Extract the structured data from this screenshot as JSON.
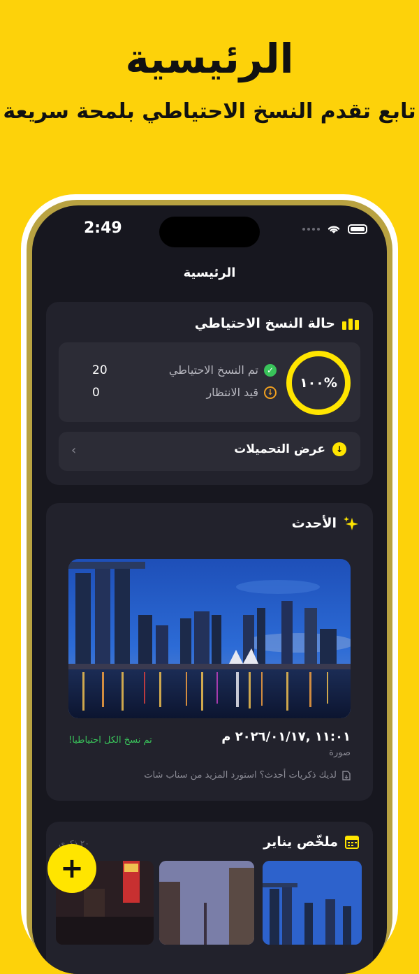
{
  "promo": {
    "title": "الرئيسية",
    "subtitle": "تابع تقدم النسخ الاحتياطي بلمحة سريعة"
  },
  "status_bar": {
    "time": "2:49"
  },
  "nav": {
    "title": "الرئيسية"
  },
  "backup_status": {
    "title": "حالة النسخ الاحتياطي",
    "progress_label": "١٠٠%",
    "progress_fraction": 1.0,
    "stats": [
      {
        "label": "تم النسخ الاحتياطي",
        "value": "20",
        "color": "#39C35A",
        "icon": "check-circle-icon"
      },
      {
        "label": "قيد الانتظار",
        "value": "0",
        "color": "#F0A020",
        "icon": "pending-down-icon"
      }
    ],
    "view_downloads": "عرض التحميلات"
  },
  "latest": {
    "title": "الأحدث",
    "date": "١١:٠١ ,٢٠٢٦/٠١/١٧ م",
    "type": "صورة",
    "backed_up": "تم نسخ الكل احتياطيا!",
    "promo": "لديك ذكريات أحدث؟ استورد المزيد من سناب شات"
  },
  "summary": {
    "title": "ملخّص يناير",
    "count": "٢٠ ذكرى"
  },
  "fab": {
    "label": "+"
  },
  "colors": {
    "accent": "#FFE500",
    "background": "#FDD20A",
    "screen": "#17171F",
    "card": "#22222C"
  }
}
